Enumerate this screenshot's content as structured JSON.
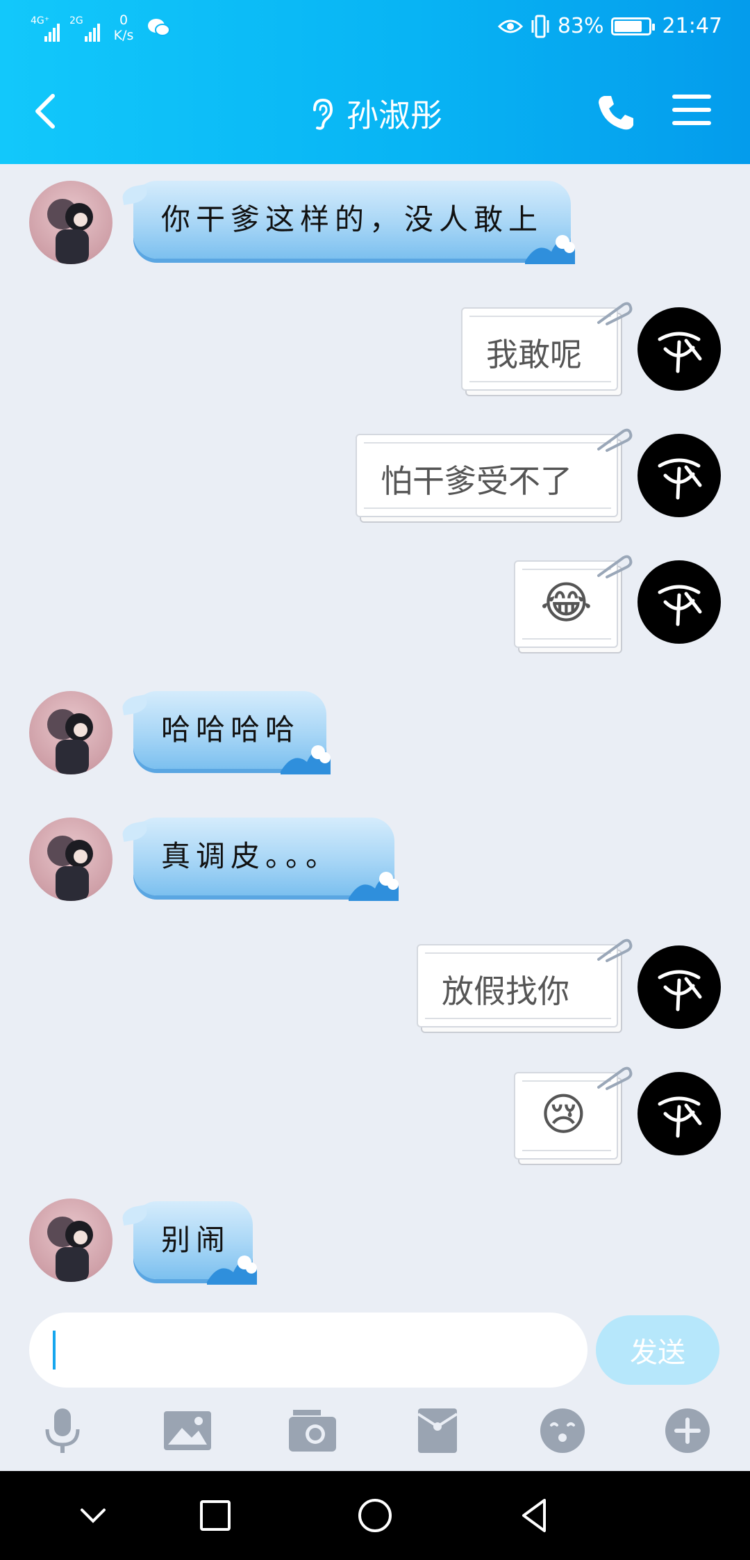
{
  "status_bar": {
    "signal1": "4G⁺",
    "signal2": "2G",
    "speed_value": "0",
    "speed_unit": "K/s",
    "battery": "83%",
    "time": "21:47"
  },
  "header": {
    "title": "孙淑彤",
    "icons": [
      "back-arrow-icon",
      "ear-icon",
      "phone-icon",
      "menu-icon"
    ]
  },
  "messages": [
    {
      "side": "in",
      "text": "你干爹这样的，没人敢上"
    },
    {
      "side": "out",
      "text": "我敢呢"
    },
    {
      "side": "out",
      "text": "怕干爹受不了"
    },
    {
      "side": "out",
      "emoji": "😂"
    },
    {
      "side": "in",
      "text": "哈哈哈哈"
    },
    {
      "side": "in",
      "text": "真调皮。。。"
    },
    {
      "side": "out",
      "text": "放假找你"
    },
    {
      "side": "out",
      "emoji": "😢"
    },
    {
      "side": "in",
      "text": "别闹"
    }
  ],
  "composer": {
    "input_value": "",
    "send_label": "发送"
  },
  "toolbar": [
    "microphone-icon",
    "image-icon",
    "camera-icon",
    "red-packet-icon",
    "sticker-icon",
    "plus-icon"
  ],
  "system_nav": [
    "hide-keyboard-icon",
    "recents-icon",
    "home-icon",
    "back-icon"
  ],
  "colors": {
    "header_start": "#12c8fb",
    "header_end": "#049cec",
    "chat_background": "#eaeef5",
    "send_button": "#b6e7fb"
  }
}
